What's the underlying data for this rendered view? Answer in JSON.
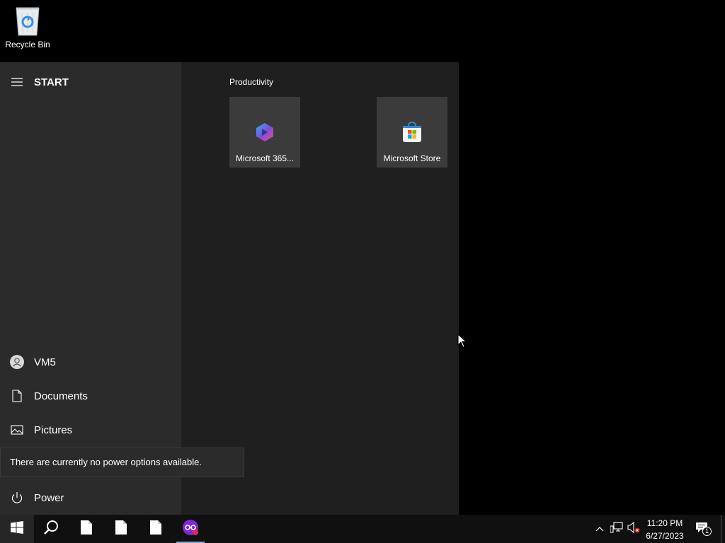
{
  "desktop": {
    "icons": [
      {
        "label": "Recycle Bin",
        "icon": "recycle-bin-icon"
      }
    ]
  },
  "start_menu": {
    "header_label": "START",
    "side_items": [
      {
        "label": "VM5",
        "icon": "user-avatar-icon"
      },
      {
        "label": "Documents",
        "icon": "document-icon"
      },
      {
        "label": "Pictures",
        "icon": "pictures-icon"
      },
      {
        "label": "Power",
        "icon": "power-icon"
      }
    ],
    "group_title": "Productivity",
    "tiles": [
      {
        "label": "Microsoft 365...",
        "icon": "microsoft-365-icon"
      },
      {
        "label": "Microsoft Store",
        "icon": "microsoft-store-icon"
      }
    ],
    "tooltip": "There are currently no power options available."
  },
  "taskbar": {
    "buttons": [
      "windows-start-icon",
      "search-icon",
      "file-icon",
      "file-icon",
      "file-icon",
      "incognito-app-icon"
    ],
    "tray": {
      "icons": [
        "chevron-up-icon",
        "network-icon",
        "volume-muted-icon"
      ],
      "time": "11:20 PM",
      "date": "6/27/2023",
      "notification_count": "1"
    }
  },
  "colors": {
    "accent": "#7aa7d9",
    "tile": "#3b3b3b",
    "menu_left": "#2b2b2b",
    "menu_right": "#1f1f1f"
  }
}
